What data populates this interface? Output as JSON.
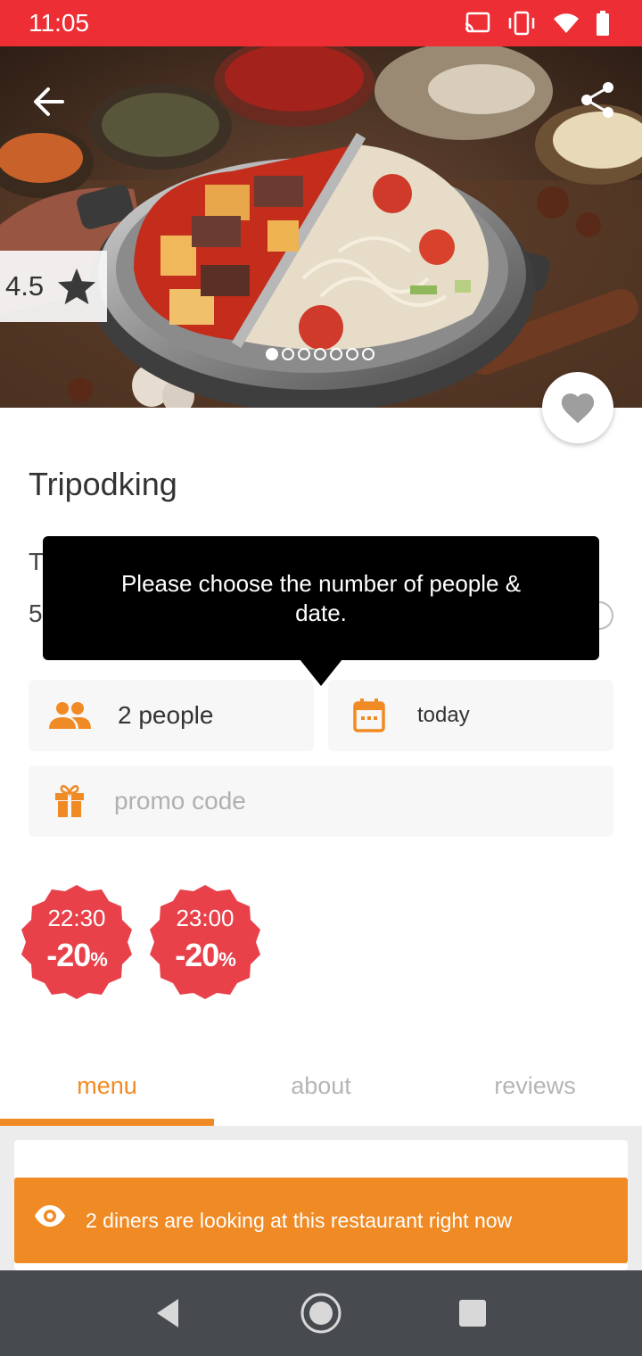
{
  "status_bar": {
    "time": "11:05",
    "icons": [
      "cast-icon",
      "vibrate-icon",
      "wifi-icon",
      "battery-icon"
    ]
  },
  "hero": {
    "image": "hotpot-photo",
    "rating": "4.5",
    "carousel_count": 7,
    "carousel_active": 0
  },
  "restaurant": {
    "name": "Tripodking",
    "partial_line_1": "T",
    "partial_line_2": "5"
  },
  "tooltip": {
    "text": "Please choose the number of people & date."
  },
  "booking": {
    "people": "2 people",
    "date": "today",
    "promo_placeholder": "promo code"
  },
  "deals": [
    {
      "time": "22:30",
      "discount": "-20",
      "unit": "%"
    },
    {
      "time": "23:00",
      "discount": "-20",
      "unit": "%"
    }
  ],
  "tabs": [
    {
      "label": "menu",
      "active": true
    },
    {
      "label": "about",
      "active": false
    },
    {
      "label": "reviews",
      "active": false
    }
  ],
  "live_banner": {
    "text": "2 diners are looking at this restaurant right now"
  },
  "colors": {
    "status_red": "#ee2e35",
    "accent_orange": "#f08a24",
    "deal_red": "#e8414a",
    "nav_bar": "#474b50"
  }
}
